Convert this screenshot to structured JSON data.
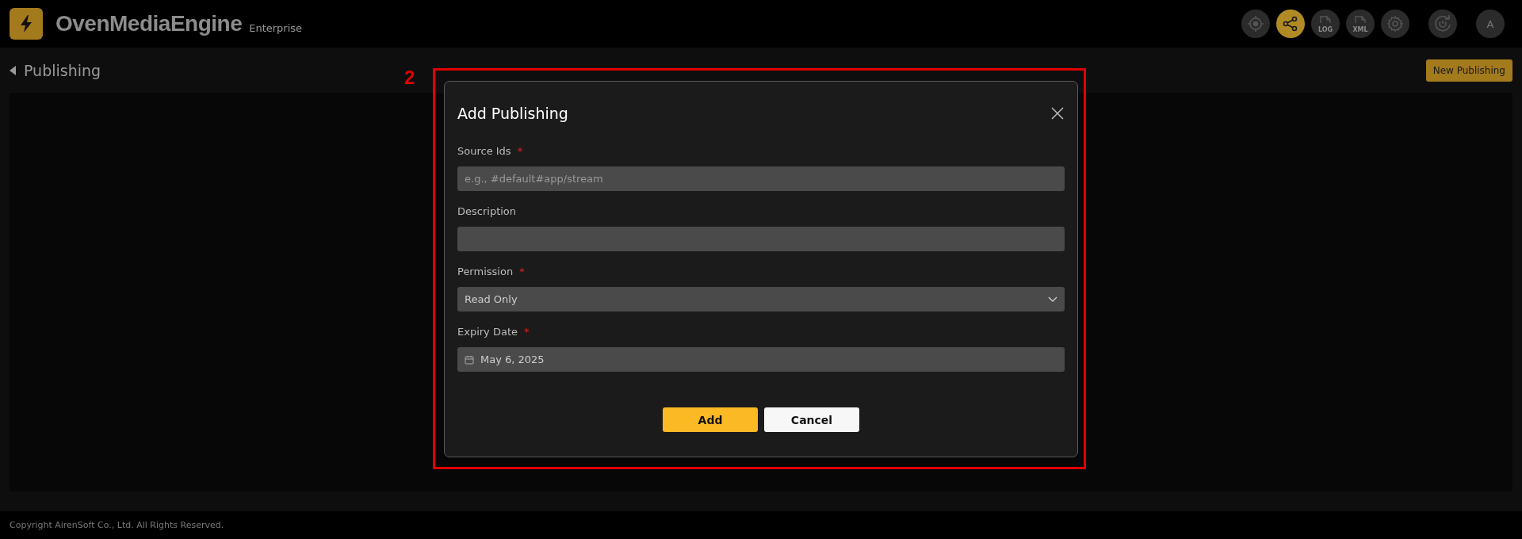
{
  "header": {
    "brand": "OvenMediaEngine",
    "edition": "Enterprise",
    "icons": [
      {
        "kind": "target",
        "selected": false
      },
      {
        "kind": "share",
        "selected": true
      },
      {
        "kind": "file",
        "label": "LOG",
        "selected": false
      },
      {
        "kind": "file",
        "label": "XML",
        "selected": false
      },
      {
        "kind": "gear",
        "selected": false
      },
      {
        "kind": "power",
        "selected": false
      },
      {
        "kind": "avatar",
        "label": "A",
        "selected": false
      }
    ]
  },
  "page": {
    "title": "Publishing",
    "action": "New Publishing"
  },
  "annotation": {
    "label": "2"
  },
  "dialog": {
    "title": "Add Publishing",
    "fields": [
      {
        "kind": "text",
        "label": "Source Ids",
        "marker": "*",
        "placeholder": "e.g., #default#app/stream"
      },
      {
        "kind": "text",
        "label": "Description"
      },
      {
        "kind": "select",
        "label": "Permission",
        "marker": "*",
        "value": "Read Only"
      },
      {
        "kind": "date",
        "label": "Expiry Date",
        "marker": "*",
        "value": "May 6, 2025"
      }
    ],
    "buttons": [
      {
        "kind": "primary",
        "label": "Add"
      },
      {
        "kind": "secondary",
        "label": "Cancel"
      }
    ]
  },
  "footer": "Copyright AirenSoft Co., Ltd. All Rights Reserved."
}
